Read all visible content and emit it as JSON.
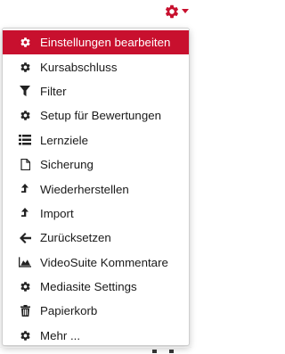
{
  "colors": {
    "accent": "#c8102e",
    "text": "#1a1a1a",
    "active_text": "#ffffff"
  },
  "toggle": {
    "icon": "gear-icon",
    "caret_icon": "caret-down-icon"
  },
  "menu": {
    "items": [
      {
        "label": "Einstellungen bearbeiten",
        "icon": "gear-icon",
        "active": true
      },
      {
        "label": "Kursabschluss",
        "icon": "gear-icon"
      },
      {
        "label": "Filter",
        "icon": "filter-icon"
      },
      {
        "label": "Setup für Bewertungen",
        "icon": "gear-icon"
      },
      {
        "label": "Lernziele",
        "icon": "list-icon"
      },
      {
        "label": "Sicherung",
        "icon": "file-icon"
      },
      {
        "label": "Wiederherstellen",
        "icon": "upload-arrow-icon"
      },
      {
        "label": "Import",
        "icon": "upload-arrow-icon"
      },
      {
        "label": "Zurücksetzen",
        "icon": "arrow-left-icon"
      },
      {
        "label": "VideoSuite Kommentare",
        "icon": "area-chart-icon"
      },
      {
        "label": "Mediasite Settings",
        "icon": "gear-icon"
      },
      {
        "label": "Papierkorb",
        "icon": "trash-icon"
      },
      {
        "label": "Mehr ...",
        "icon": "gear-icon"
      }
    ]
  }
}
